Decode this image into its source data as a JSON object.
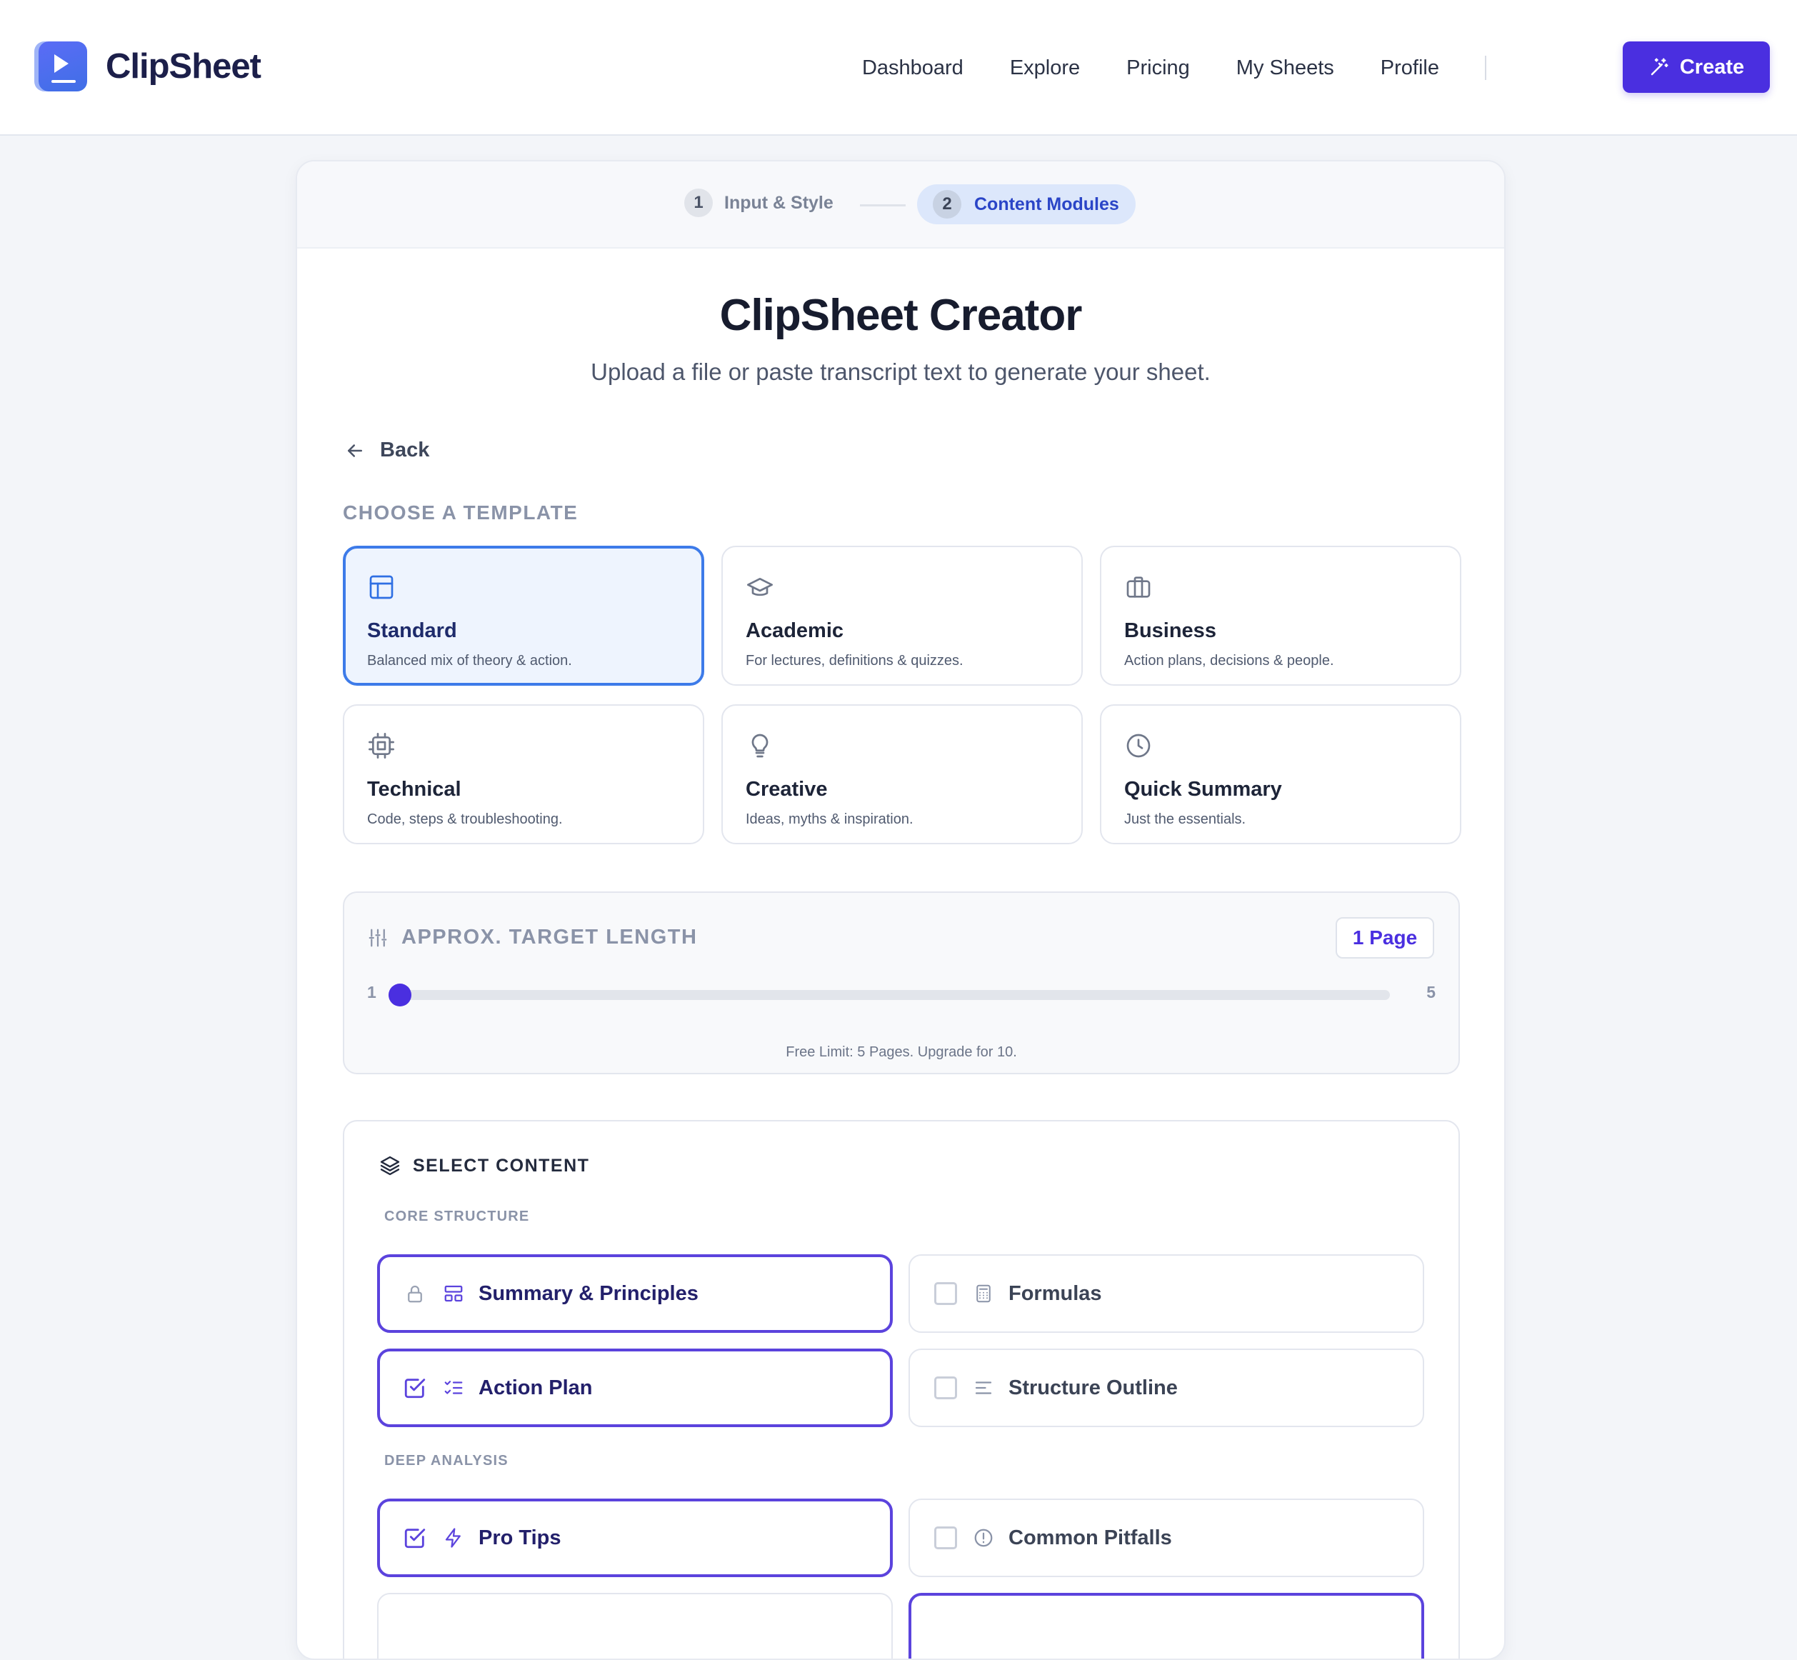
{
  "app": {
    "name": "ClipSheet"
  },
  "nav": {
    "links": [
      "Dashboard",
      "Explore",
      "Pricing",
      "My Sheets",
      "Profile"
    ],
    "create_label": "Create"
  },
  "stepper": {
    "steps": [
      {
        "num": "1",
        "label": "Input & Style",
        "state": "done"
      },
      {
        "num": "2",
        "label": "Content Modules",
        "state": "active"
      }
    ]
  },
  "page": {
    "title": "ClipSheet Creator",
    "subtitle": "Upload a file or paste transcript text to generate your sheet.",
    "back_label": "Back"
  },
  "templates": {
    "heading": "CHOOSE A TEMPLATE",
    "items": [
      {
        "name": "Standard",
        "desc": "Balanced mix of theory & action.",
        "icon": "layout-icon",
        "selected": true
      },
      {
        "name": "Academic",
        "desc": "For lectures, definitions & quizzes.",
        "icon": "graduation-cap-icon",
        "selected": false
      },
      {
        "name": "Business",
        "desc": "Action plans, decisions & people.",
        "icon": "briefcase-icon",
        "selected": false
      },
      {
        "name": "Technical",
        "desc": "Code, steps & troubleshooting.",
        "icon": "cpu-icon",
        "selected": false
      },
      {
        "name": "Creative",
        "desc": "Ideas, myths & inspiration.",
        "icon": "lightbulb-icon",
        "selected": false
      },
      {
        "name": "Quick Summary",
        "desc": "Just the essentials.",
        "icon": "clock-icon",
        "selected": false
      }
    ]
  },
  "length": {
    "heading": "APPROX. TARGET LENGTH",
    "value_label": "1 Page",
    "min": "1",
    "max": "5",
    "value": 1,
    "note": "Free Limit: 5 Pages. Upgrade for 10."
  },
  "content": {
    "heading": "SELECT CONTENT",
    "groups": [
      {
        "label": "CORE STRUCTURE"
      },
      {
        "label": "DEEP ANALYSIS"
      }
    ],
    "modules": [
      {
        "label": "Summary & Principles",
        "state": "locked",
        "icon": "layout-rows-icon"
      },
      {
        "label": "Formulas",
        "state": "off",
        "icon": "calculator-icon"
      },
      {
        "label": "Action Plan",
        "state": "on",
        "icon": "list-checks-icon"
      },
      {
        "label": "Structure Outline",
        "state": "off",
        "icon": "align-left-icon"
      },
      {
        "label": "Pro Tips",
        "state": "on",
        "icon": "lightning-icon"
      },
      {
        "label": "Common Pitfalls",
        "state": "off",
        "icon": "alert-circle-icon"
      }
    ]
  },
  "colors": {
    "accent": "#4a2fe0",
    "selected_template_border": "#3d7be9",
    "selected_template_bg": "#eef4fe",
    "module_on_border": "#5b43dd",
    "step_active_bg": "#dce7fb"
  }
}
